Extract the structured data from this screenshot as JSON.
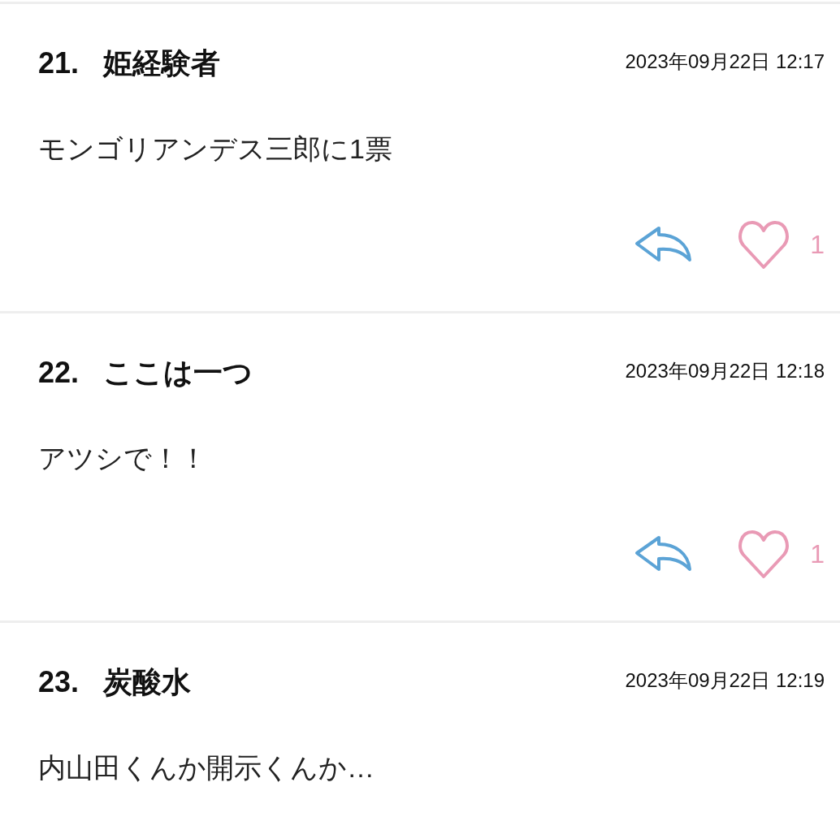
{
  "posts": [
    {
      "number": "21.",
      "name": "姫経験者",
      "date": "2023年09月22日 12:17",
      "body": "モンゴリアンデス三郎に1票",
      "likes": "1"
    },
    {
      "number": "22.",
      "name": "ここは一つ",
      "date": "2023年09月22日 12:18",
      "body": "アツシで！！",
      "likes": "1"
    },
    {
      "number": "23.",
      "name": "炭酸水",
      "date": "2023年09月22日 12:19",
      "body": "内山田くんか開示くんか…"
    }
  ]
}
